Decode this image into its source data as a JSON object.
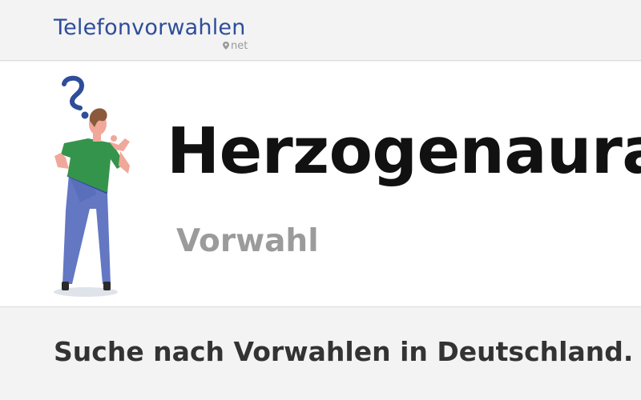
{
  "header": {
    "logo_text": "Telefonvorwahlen",
    "logo_tld": "net",
    "brand_color": "#2e4d9a"
  },
  "hero": {
    "illustration": "person-thinking-question-mark",
    "city_name": "Herzogenaurach",
    "subtitle": "Vorwahl"
  },
  "search": {
    "heading": "Suche nach Vorwahlen in Deutschland."
  },
  "colors": {
    "background": "#f3f3f3",
    "hero_background": "#ffffff",
    "title": "#111111",
    "subtitle": "#9b9b9b",
    "body_text": "#333333"
  }
}
